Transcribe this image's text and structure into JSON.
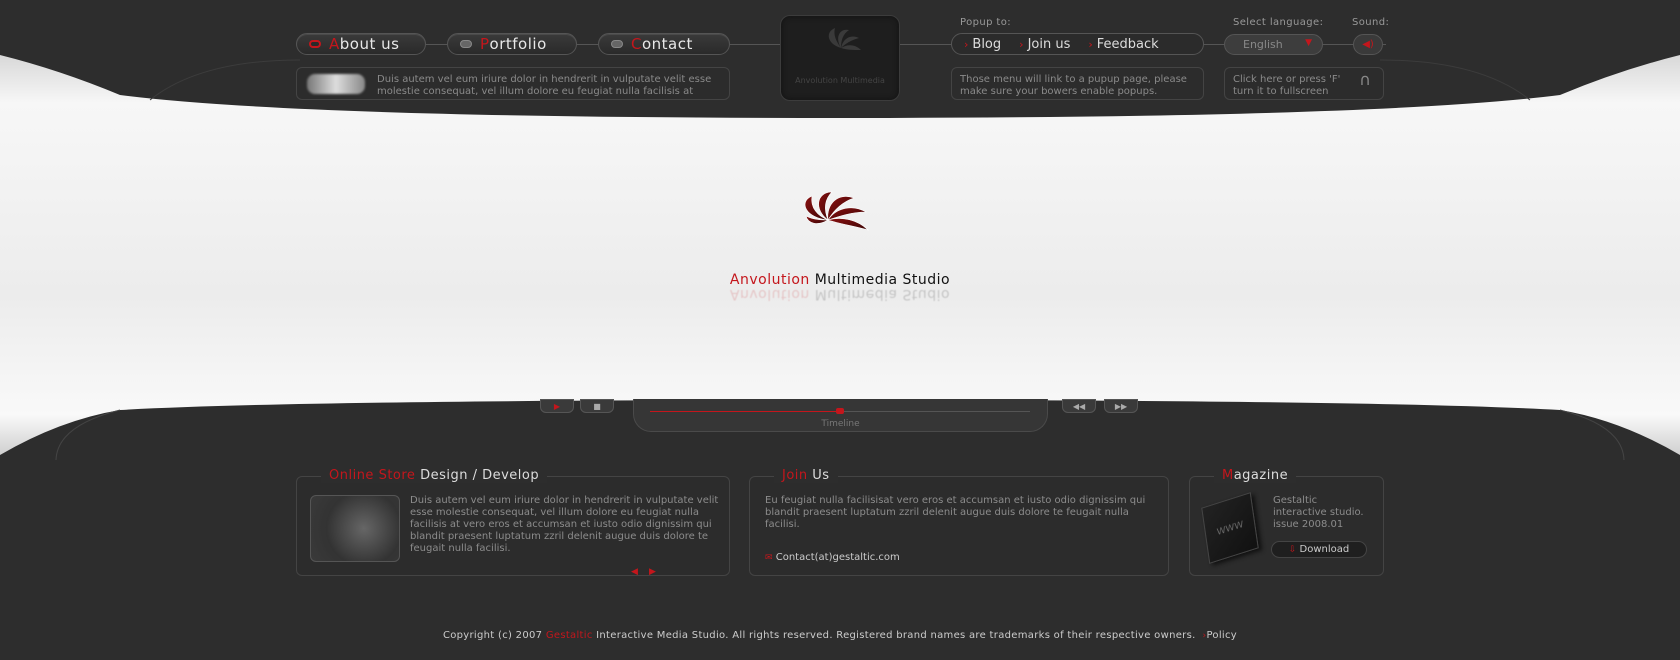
{
  "nav": {
    "about": {
      "first": "A",
      "rest": "bout us"
    },
    "portfolio": {
      "first": "P",
      "rest": "ortfolio"
    },
    "contact": {
      "first": "C",
      "rest": "ontact"
    }
  },
  "news_text": "Duis autem vel eum iriure dolor in hendrerit in vulputate velit esse molestie consequat, vel illum dolore eu feugiat nulla facilisis at",
  "logo_tile_text": "Anvolution Multimedia",
  "popup": {
    "label": "Popup to:",
    "items": [
      "Blog",
      "Join us",
      "Feedback"
    ],
    "note": "Those menu will link to a pupup page, please make sure your bowers enable popups."
  },
  "language": {
    "label": "Select language:",
    "value": "English"
  },
  "sound": {
    "label": "Sound:"
  },
  "fullscreen_note": "Click here or press 'F' turn it to fullscreen",
  "hero": {
    "brand_red": "Anvolution",
    "brand_rest": " Multimedia Studio"
  },
  "player": {
    "timeline_label": "Timeline",
    "progress": 0.5
  },
  "store": {
    "title_red": "Online Store",
    "title_rest": " Design / Develop",
    "text": "Duis autem vel eum iriure dolor in hendrerit in vulputate velit esse molestie consequat, vel illum dolore eu feugiat nulla facilisis at vero eros et accumsan et iusto odio dignissim qui blandit praesent luptatum zzril delenit augue duis dolore te feugait nulla facilisi."
  },
  "join": {
    "title_red": "Join",
    "title_rest": " Us",
    "text": "Eu feugiat nulla facilisisat vero eros et accumsan et iusto odio dignissim qui blandit praesent luptatum zzril delenit augue duis dolore te feugait nulla facilisi.",
    "email": "Contact(at)gestaltic.com"
  },
  "magazine": {
    "title_red": "M",
    "title_rest": "agazine",
    "text": "Gestaltic interactive studio. issue 2008.01",
    "download": "Download"
  },
  "footer": {
    "pre": "Copyright (c) 2007 ",
    "brand": "Gestaltic",
    "post": " Interactive Media Studio. All rights reserved. Registered brand names are trademarks of their respective owners.",
    "policy": "Policy"
  },
  "colors": {
    "accent": "#c4161c",
    "bg": "#2d2d2d",
    "hero": "#f0f0f0"
  }
}
